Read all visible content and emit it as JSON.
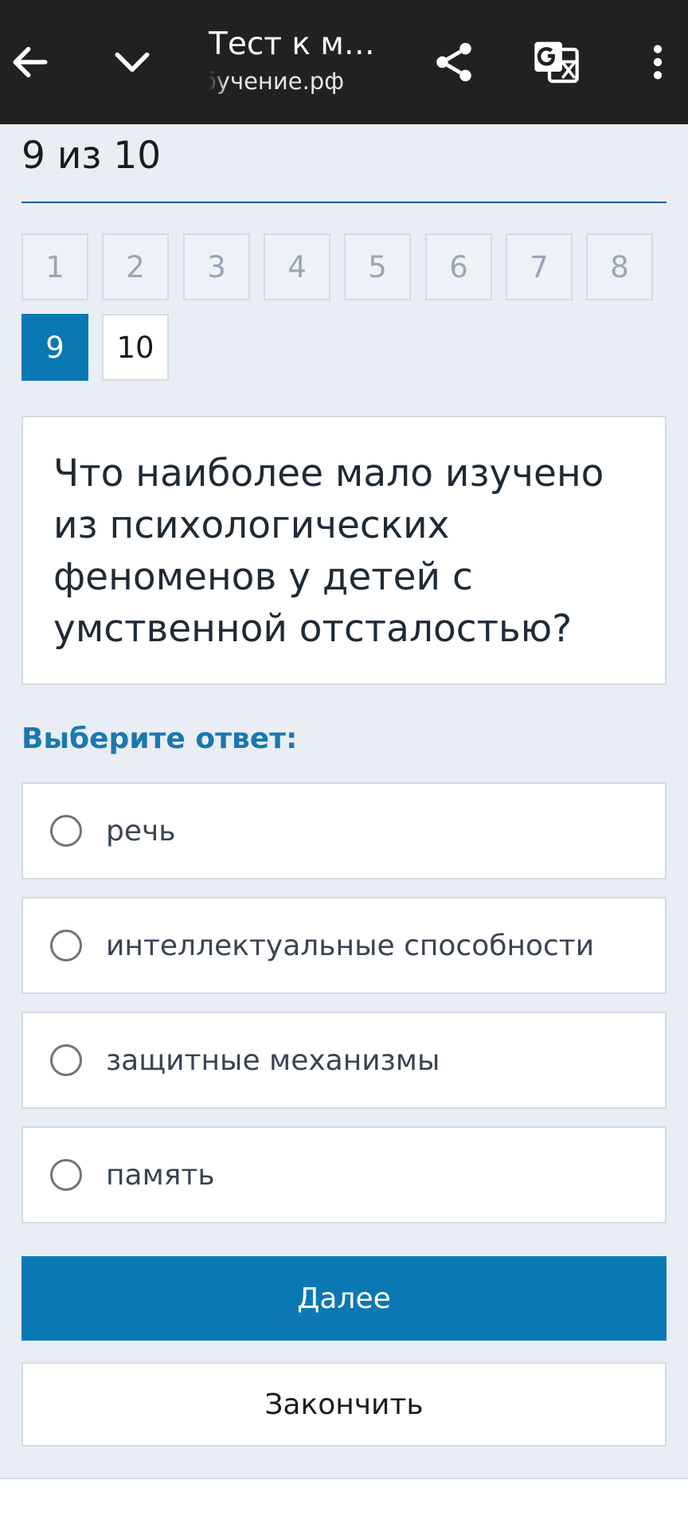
{
  "browser_bar": {
    "title": "Тест к мо...",
    "url": "обучение.рф",
    "icons": {
      "back": "back-arrow-icon",
      "collapse": "chevron-down-icon",
      "share": "share-icon",
      "translate": "translate-icon",
      "menu": "more-vert-icon"
    }
  },
  "quiz": {
    "progress_text": "9 из 10",
    "questions": [
      {
        "number": "1",
        "state": "visited"
      },
      {
        "number": "2",
        "state": "visited"
      },
      {
        "number": "3",
        "state": "visited"
      },
      {
        "number": "4",
        "state": "visited"
      },
      {
        "number": "5",
        "state": "visited"
      },
      {
        "number": "6",
        "state": "visited"
      },
      {
        "number": "7",
        "state": "visited"
      },
      {
        "number": "8",
        "state": "visited"
      },
      {
        "number": "9",
        "state": "current"
      },
      {
        "number": "10",
        "state": "unanswered"
      }
    ],
    "question_text": "Что наиболее мало изучено из психологических феноменов у детей с умственной отсталостью?",
    "answer_prompt": "Выберите ответ:",
    "options": [
      {
        "label": "речь",
        "selected": false
      },
      {
        "label": "интеллектуальные способности",
        "selected": false
      },
      {
        "label": "защитные механизмы",
        "selected": false
      },
      {
        "label": "память",
        "selected": false
      }
    ],
    "next_label": "Далее",
    "finish_label": "Закончить"
  },
  "colors": {
    "top_bar": "#212121",
    "page_background": "#e9eef4",
    "accent": "#0b78b4",
    "prompt_text": "#1a78b0",
    "border": "#d4dbe3"
  }
}
